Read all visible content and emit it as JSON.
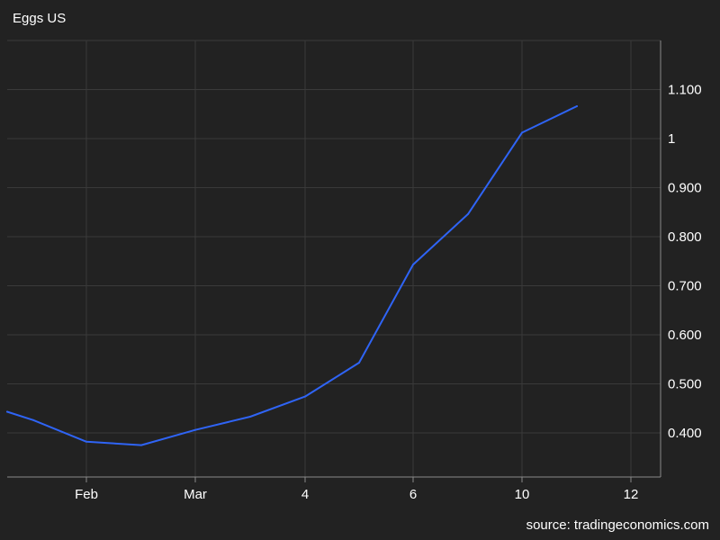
{
  "title": "Eggs US",
  "source": "source: tradingeconomics.com",
  "colors": {
    "background": "#222222",
    "grid": "#3a3a3a",
    "axis": "#8a8a8a",
    "line": "#2f64f5",
    "text": "#ffffff"
  },
  "chart_data": {
    "type": "line",
    "title": "Eggs US",
    "xlabel": "",
    "ylabel": "",
    "grid": true,
    "y_axis_side": "right",
    "x_ticks": [
      "Feb",
      "Mar",
      "4",
      "6",
      "10",
      "12"
    ],
    "y_ticks": [
      "0.400",
      "0.500",
      "0.600",
      "0.700",
      "0.800",
      "0.900",
      "1",
      "1.100"
    ],
    "y_tick_values": [
      0.4,
      0.5,
      0.6,
      0.7,
      0.8,
      0.9,
      1.0,
      1.1
    ],
    "ylim": [
      0.31,
      1.2
    ],
    "series": [
      {
        "values": [
          0.443,
          0.426,
          0.382,
          0.375,
          0.406,
          0.433,
          0.474,
          0.543,
          0.743,
          0.846,
          1.012,
          1.066
        ]
      }
    ]
  }
}
